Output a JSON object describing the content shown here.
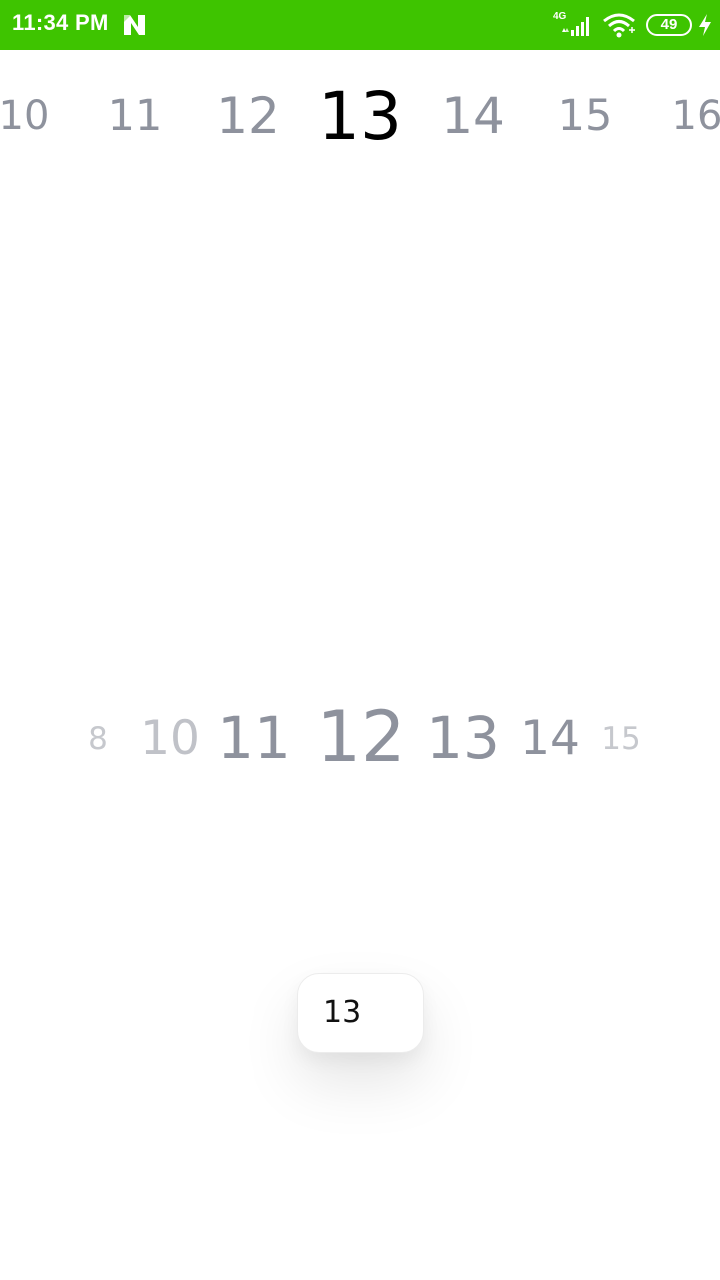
{
  "status_bar": {
    "time": "11:34 PM",
    "network_type": "4G",
    "battery_level": "49",
    "notification_icon": "n-notification-icon",
    "icons": [
      "signal-icon",
      "wifi-icon",
      "battery-icon",
      "charging-bolt-icon"
    ],
    "background_color": "#3ec400"
  },
  "top_ruler": {
    "selected_value": "13",
    "numbers": [
      "10",
      "11",
      "12",
      "13",
      "14",
      "15",
      "16"
    ]
  },
  "middle_ruler": {
    "selected_value": "12",
    "numbers": [
      "8",
      "10",
      "11",
      "12",
      "13",
      "14",
      "15"
    ]
  },
  "value_card": {
    "value": "13"
  }
}
